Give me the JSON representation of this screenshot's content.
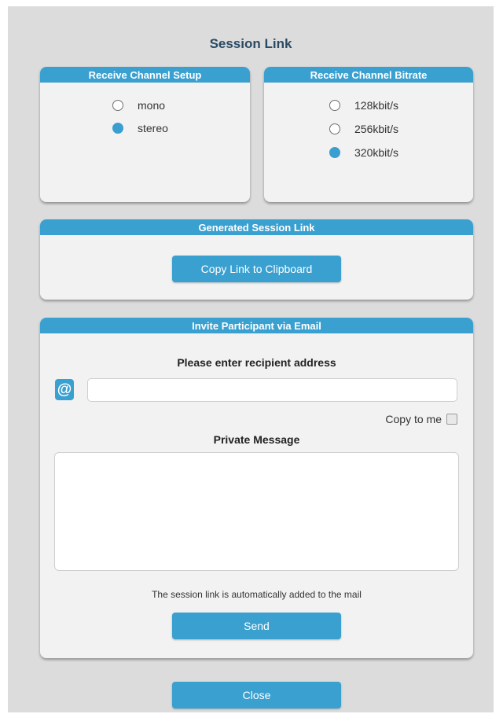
{
  "dialog": {
    "title": "Session Link",
    "close_label": "Close"
  },
  "receive_channel_setup": {
    "header": "Receive Channel Setup",
    "options": [
      {
        "label": "mono",
        "selected": false
      },
      {
        "label": "stereo",
        "selected": true
      }
    ]
  },
  "receive_channel_bitrate": {
    "header": "Receive Channel Bitrate",
    "options": [
      {
        "label": "128kbit/s",
        "selected": false
      },
      {
        "label": "256kbit/s",
        "selected": false
      },
      {
        "label": "320kbit/s",
        "selected": true
      }
    ]
  },
  "generated_link": {
    "header": "Generated Session Link",
    "copy_button": "Copy Link to Clipboard"
  },
  "invite": {
    "header": "Invite Participant via Email",
    "recipient_label": "Please enter recipient address",
    "email_icon": "@",
    "email_value": "",
    "copy_to_me_label": "Copy to me",
    "copy_to_me_checked": false,
    "message_label": "Private Message",
    "message_value": "",
    "note": "The session link is automatically added to the mail",
    "send_label": "Send"
  },
  "colors": {
    "accent": "#3aa0d0",
    "background": "#dcdcdc",
    "panel": "#f2f2f2"
  }
}
